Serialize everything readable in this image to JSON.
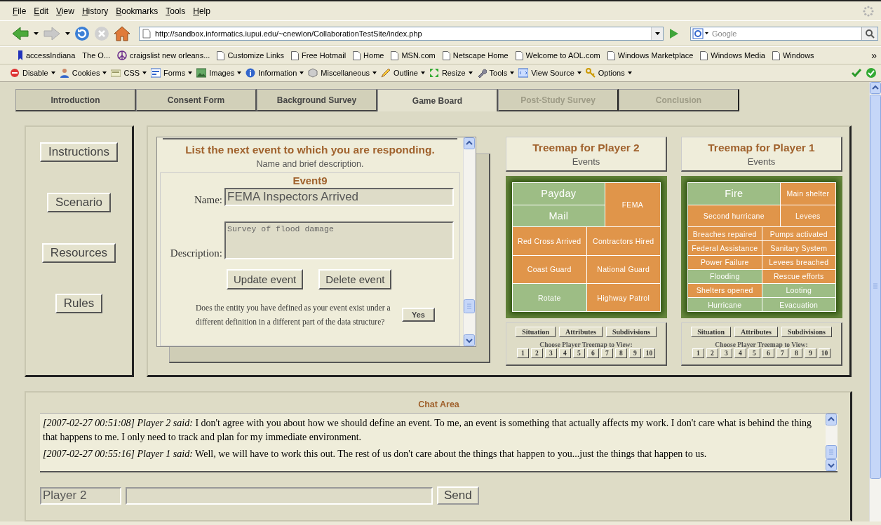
{
  "menu": [
    "File",
    "Edit",
    "View",
    "History",
    "Bookmarks",
    "Tools",
    "Help"
  ],
  "nav_buttons": [
    {
      "kind": "back",
      "disabled": false
    },
    {
      "kind": "forward",
      "disabled": true
    },
    {
      "kind": "reload",
      "disabled": false
    },
    {
      "kind": "stop",
      "disabled": true
    },
    {
      "kind": "home",
      "disabled": false
    }
  ],
  "address": {
    "url": "http://sandbox.informatics.iupui.edu/~cnewlon/CollaborationTestSite/index.php"
  },
  "search": {
    "placeholder": "Google"
  },
  "bookmarks": [
    {
      "label": "accessIndiana",
      "kind": "site"
    },
    {
      "label": "The O...",
      "kind": "plain"
    },
    {
      "label": "craigslist new orleans...",
      "kind": "peace"
    },
    {
      "label": "Customize Links",
      "kind": "page"
    },
    {
      "label": "Free Hotmail",
      "kind": "page"
    },
    {
      "label": "Home",
      "kind": "page"
    },
    {
      "label": "MSN.com",
      "kind": "page"
    },
    {
      "label": "Netscape Home",
      "kind": "page"
    },
    {
      "label": "Welcome to AOL.com",
      "kind": "page"
    },
    {
      "label": "Windows Marketplace",
      "kind": "page"
    },
    {
      "label": "Windows Media",
      "kind": "page"
    },
    {
      "label": "Windows",
      "kind": "page"
    }
  ],
  "bookmarks_more": "»",
  "dev_tools": [
    {
      "label": "Disable",
      "kind": "disable"
    },
    {
      "label": "Cookies",
      "kind": "cookies"
    },
    {
      "label": "CSS",
      "kind": "css"
    },
    {
      "label": "Forms",
      "kind": "forms"
    },
    {
      "label": "Images",
      "kind": "images"
    },
    {
      "label": "Information",
      "kind": "information"
    },
    {
      "label": "Miscellaneous",
      "kind": "miscellaneous"
    },
    {
      "label": "Outline",
      "kind": "outline"
    },
    {
      "label": "Resize",
      "kind": "resize"
    },
    {
      "label": "Tools",
      "kind": "tools"
    },
    {
      "label": "View Source",
      "kind": "source"
    },
    {
      "label": "Options",
      "kind": "options"
    }
  ],
  "tabs": [
    {
      "label": "Introduction",
      "selected": false,
      "disabled": false
    },
    {
      "label": "Consent Form",
      "selected": false,
      "disabled": false
    },
    {
      "label": "Background Survey",
      "selected": false,
      "disabled": false
    },
    {
      "label": "Game Board",
      "selected": true,
      "disabled": false
    },
    {
      "label": "Post-Study Survey",
      "selected": false,
      "disabled": true
    },
    {
      "label": "Conclusion",
      "selected": false,
      "disabled": true
    }
  ],
  "side_buttons": [
    "Instructions",
    "Scenario",
    "Resources",
    "Rules"
  ],
  "event_form": {
    "heading": "List the next event to which you are responding.",
    "subheading": "Name and brief description.",
    "event_title": "Event9",
    "name_label": "Name:",
    "name_value": "FEMA Inspectors Arrived",
    "description_label": "Description:",
    "description_value": "Survey of flood damage",
    "buttons": [
      "Update event",
      "Delete event"
    ],
    "question": "Does the entity you have defined as your event exist under a different definition in a different part of the data structure?",
    "answer_button": "Yes"
  },
  "treemaps": [
    {
      "title": "Treemap for Player 2",
      "subtitle": "Events",
      "upper_left": [
        {
          "label": "Payday",
          "color": "#9dbd85"
        },
        {
          "label": "Mail",
          "color": "#9dbd85"
        }
      ],
      "upper_right": [
        {
          "label": "FEMA",
          "color": "#e0954a"
        }
      ],
      "lower": [
        {
          "label": "Red Cross Arrived",
          "color": "#e0954a"
        },
        {
          "label": "Contractors Hired",
          "color": "#e0954a"
        },
        {
          "label": "Coast Guard",
          "color": "#e0954a"
        },
        {
          "label": "National Guard",
          "color": "#e0954a"
        },
        {
          "label": "Rotate",
          "color": "#9dbd85"
        },
        {
          "label": "Highway Patrol",
          "color": "#e0954a"
        }
      ],
      "view_buttons": [
        "Situation",
        "Attributes",
        "Subdivisions"
      ],
      "chooser_label": "Choose Player Treemap to View:",
      "pages": [
        "1",
        "2",
        "3",
        "4",
        "5",
        "6",
        "7",
        "8",
        "9",
        "10"
      ]
    },
    {
      "title": "Treemap for Player 1",
      "subtitle": "Events",
      "upper_left": [
        {
          "label": "Fire",
          "color": "#9dbd85"
        },
        {
          "label": "Second hurricane",
          "color": "#e0954a"
        }
      ],
      "upper_right": [
        {
          "label": "Main shelter",
          "color": "#e0954a"
        },
        {
          "label": "Levees",
          "color": "#e0954a"
        }
      ],
      "lower": [
        {
          "label": "Breaches repaired",
          "color": "#e0954a"
        },
        {
          "label": "Pumps activated",
          "color": "#e0954a"
        },
        {
          "label": "Federal Assistance",
          "color": "#e0954a"
        },
        {
          "label": "Sanitary System",
          "color": "#e0954a"
        },
        {
          "label": "Power Failure",
          "color": "#e0954a"
        },
        {
          "label": "Levees breached",
          "color": "#e0954a"
        },
        {
          "label": "Flooding",
          "color": "#9dbd85"
        },
        {
          "label": "Rescue efforts",
          "color": "#e0954a"
        },
        {
          "label": "Shelters opened",
          "color": "#e0954a"
        },
        {
          "label": "Looting",
          "color": "#9dbd85"
        },
        {
          "label": "Hurricane",
          "color": "#9dbd85"
        },
        {
          "label": "Evacuation",
          "color": "#9dbd85"
        }
      ],
      "view_buttons": [
        "Situation",
        "Attributes",
        "Subdivisions"
      ],
      "chooser_label": "Choose Player Treemap to View:",
      "pages": [
        "1",
        "2",
        "3",
        "4",
        "5",
        "6",
        "7",
        "8",
        "9",
        "10"
      ]
    }
  ],
  "chat": {
    "title": "Chat Area",
    "messages": [
      "*[2007-02-27 00:51:08] Player 2 said:* I don't agree with you about how we should define an event. To me, an event is something that actually affects my work. I don't care what is behind the thing that happens to me. I only need to track and plan for my immediate environment.",
      "*[2007-02-27 00:55:16] Player 1 said:* Well, we will have to work this out. The rest of us don't care about the things that happen to you...just the things that happen to us."
    ],
    "sender": "Player 2",
    "send_button": "Send"
  }
}
